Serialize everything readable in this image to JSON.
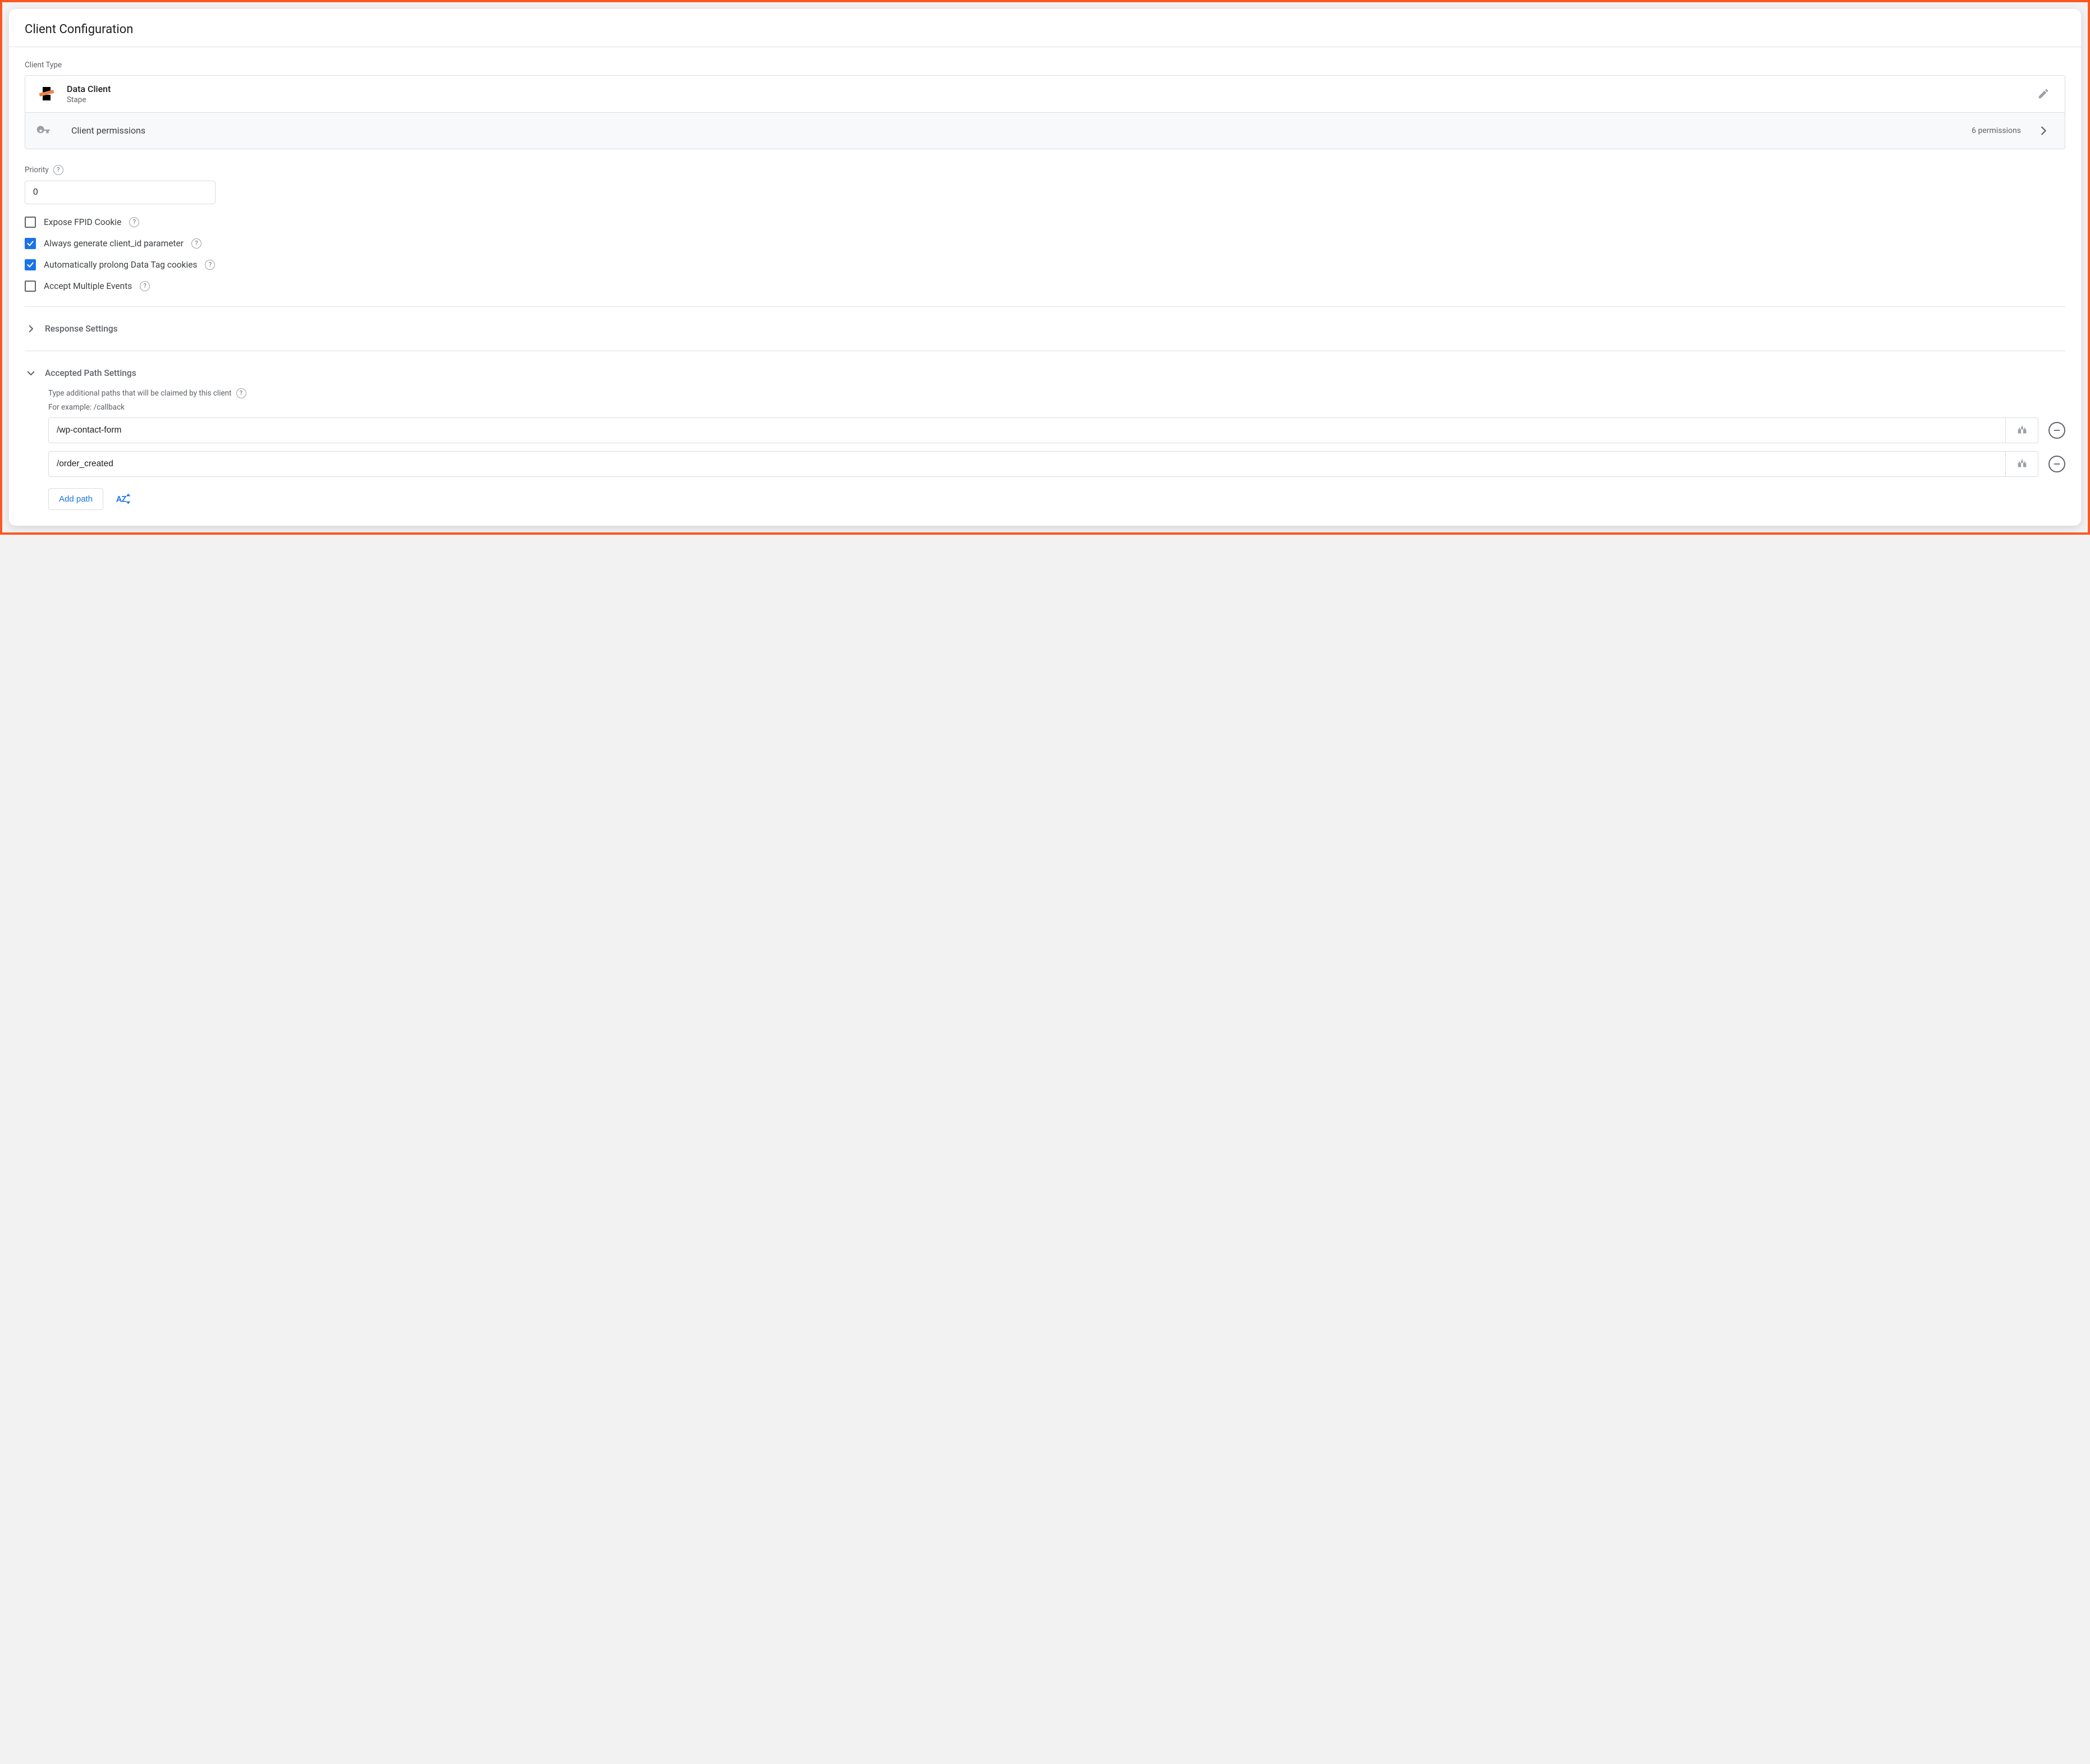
{
  "header": {
    "title": "Client Configuration"
  },
  "client_type": {
    "label": "Client Type",
    "name": "Data Client",
    "vendor": "Stape"
  },
  "permissions": {
    "label": "Client permissions",
    "count_text": "6 permissions"
  },
  "priority": {
    "label": "Priority",
    "value": "0"
  },
  "checks": {
    "expose_fpid": {
      "label": "Expose FPID Cookie",
      "checked": false
    },
    "generate_client_id": {
      "label": "Always generate client_id parameter",
      "checked": true
    },
    "prolong_cookies": {
      "label": "Automatically prolong Data Tag cookies",
      "checked": true
    },
    "accept_multiple": {
      "label": "Accept Multiple Events",
      "checked": false
    }
  },
  "sections": {
    "response_settings": {
      "title": "Response Settings",
      "expanded": false
    },
    "accepted_paths": {
      "title": "Accepted Path Settings",
      "expanded": true,
      "hint": "Type additional paths that will be claimed by this client",
      "example": "For example: /callback",
      "paths": [
        {
          "value": "/wp-contact-form"
        },
        {
          "value": "/order_created"
        }
      ],
      "add_label": "Add path"
    }
  }
}
